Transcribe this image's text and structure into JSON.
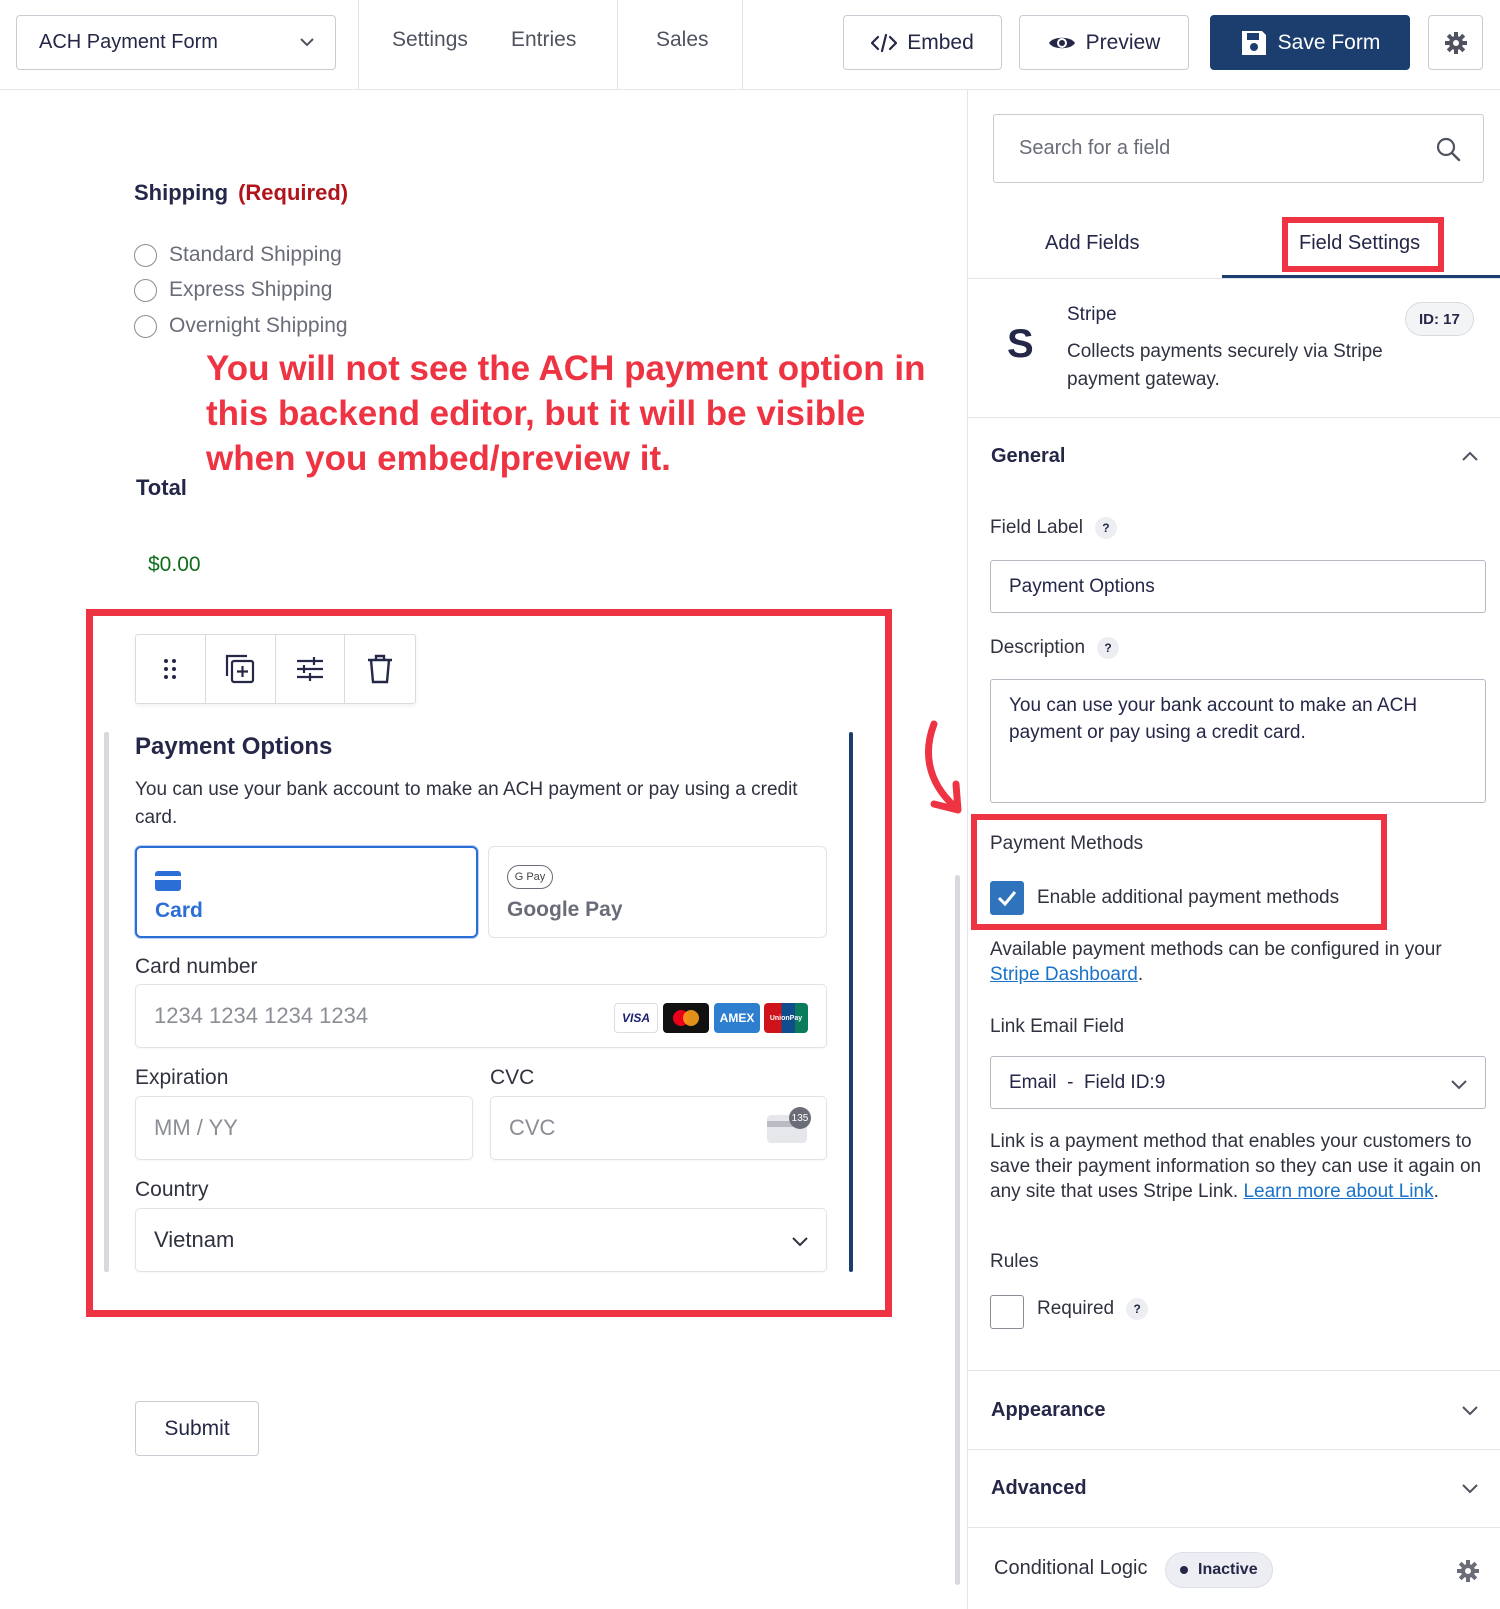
{
  "header": {
    "form_name": "ACH Payment Form",
    "nav": [
      "Settings",
      "Entries",
      "Sales"
    ],
    "embed_label": "Embed",
    "preview_label": "Preview",
    "save_label": "Save Form"
  },
  "canvas": {
    "shipping_label": "Shipping",
    "shipping_required": "(Required)",
    "shipping_options": [
      "Standard Shipping",
      "Express Shipping",
      "Overnight Shipping"
    ],
    "annotation": "You will not see the ACH payment option in this backend editor, but it will be visible when you embed/preview it.",
    "total_label": "Total",
    "total_value": "$0.00",
    "payment": {
      "title": "Payment Options",
      "description": "You can use your bank account to make an ACH payment or pay using a credit card.",
      "methods": [
        {
          "label": "Card",
          "icon": "card-icon",
          "selected": true
        },
        {
          "label": "Google Pay",
          "icon": "google-pay-icon",
          "selected": false
        }
      ],
      "gpay_chip": "G Pay",
      "card_number_label": "Card number",
      "card_number_placeholder": "1234 1234 1234 1234",
      "card_brands": [
        "VISA",
        "Mastercard",
        "AMEX",
        "UnionPay"
      ],
      "expiration_label": "Expiration",
      "expiration_placeholder": "MM / YY",
      "cvc_label": "CVC",
      "cvc_placeholder": "CVC",
      "cvc_badge": "135",
      "country_label": "Country",
      "country_value": "Vietnam"
    },
    "submit_label": "Submit"
  },
  "sidebar": {
    "search_placeholder": "Search for a field",
    "tabs": [
      "Add Fields",
      "Field Settings"
    ],
    "active_tab": "Field Settings",
    "field": {
      "icon_letter": "S",
      "name": "Stripe",
      "description": "Collects payments securely via Stripe payment gateway.",
      "id_badge": "ID: 17"
    },
    "general": {
      "title": "General",
      "field_label_label": "Field Label",
      "field_label_value": "Payment Options",
      "description_label": "Description",
      "description_value": "You can use your bank account to make an ACH payment or pay using a credit card.",
      "payment_methods_label": "Payment Methods",
      "enable_methods_label": "Enable additional payment methods",
      "enable_methods_checked": true,
      "available_text": "Available payment methods can be configured in your",
      "stripe_dashboard_link": "Stripe Dashboard",
      "link_email_label": "Link Email Field",
      "link_email_value": "Email  -  Field ID:9",
      "link_text": "Link is a payment method that enables your customers to save their payment information so they can use it again on any site that uses Stripe Link.",
      "learn_more_link": "Learn more about Link",
      "rules_label": "Rules",
      "required_label": "Required",
      "required_checked": false,
      "help_glyph": "?"
    },
    "sections": [
      "Appearance",
      "Advanced"
    ],
    "conditional_logic_label": "Conditional Logic",
    "conditional_logic_status": "Inactive"
  },
  "colors": {
    "brand": "#1b3e6e",
    "annotation_red": "#ee3342",
    "required_red": "#b0151c",
    "total_green": "#0f6e1a",
    "card_blue": "#2b6fd6",
    "link_blue": "#1a73c9"
  }
}
